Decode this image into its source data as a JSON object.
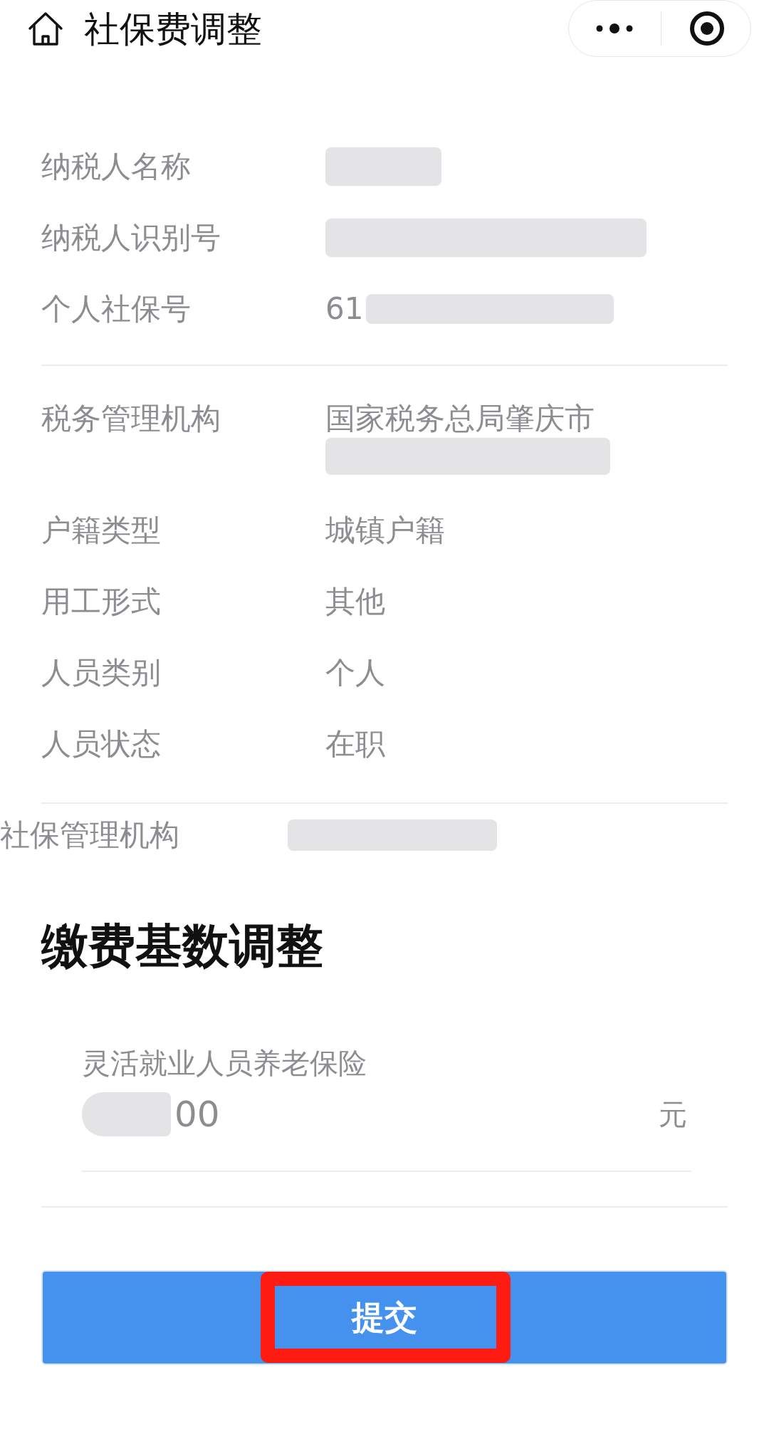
{
  "header": {
    "title": "社保费调整"
  },
  "taxpayer": [
    {
      "label": "纳税人名称",
      "redacted": true
    },
    {
      "label": "纳税人识别号",
      "redacted": true
    },
    {
      "label": "个人社保号",
      "value": "61",
      "redacted": true
    }
  ],
  "registration": [
    {
      "label": "税务管理机构",
      "value": "国家税务总局肇庆市",
      "redacted": true
    },
    {
      "label": "户籍类型",
      "value": "城镇户籍",
      "redacted": false
    },
    {
      "label": "用工形式",
      "value": "其他",
      "redacted": false
    },
    {
      "label": "人员类别",
      "value": "个人",
      "redacted": false
    },
    {
      "label": "人员状态",
      "value": "在职",
      "redacted": false
    }
  ],
  "social_security_office": {
    "label": "社保管理机构",
    "redacted": true
  },
  "base_adjustment": {
    "title": "缴费基数调整",
    "fields": [
      {
        "label": "灵活就业人员养老保险",
        "value": "00",
        "unit": "元",
        "redacted": true
      }
    ]
  },
  "submit_button": {
    "label": "提交",
    "highlighted": true
  }
}
